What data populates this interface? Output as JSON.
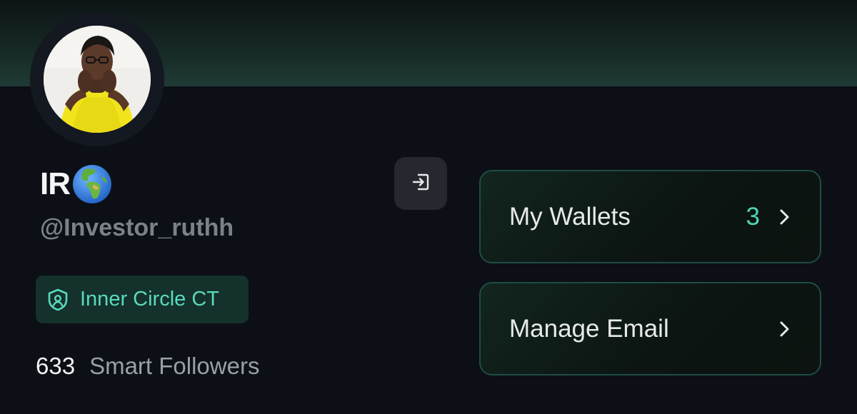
{
  "profile": {
    "display_name": "IR",
    "name_emoji": "globe-europe-africa-icon",
    "handle": "@Investor_ruthh",
    "badge": {
      "label": "Inner Circle CT",
      "icon": "shield-user-icon",
      "color": "#5ad9bd"
    },
    "followers": {
      "count": "633",
      "label": "Smart Followers"
    }
  },
  "actions": {
    "logout_icon": "logout-icon"
  },
  "menu": {
    "items": [
      {
        "label": "My Wallets",
        "count": "3",
        "icon": "chevron-right-icon"
      },
      {
        "label": "Manage Email",
        "count": "",
        "icon": "chevron-right-icon"
      }
    ]
  },
  "colors": {
    "background": "#0c0f15",
    "accent": "#4fd6b5",
    "card_border": "#1e4d43"
  }
}
